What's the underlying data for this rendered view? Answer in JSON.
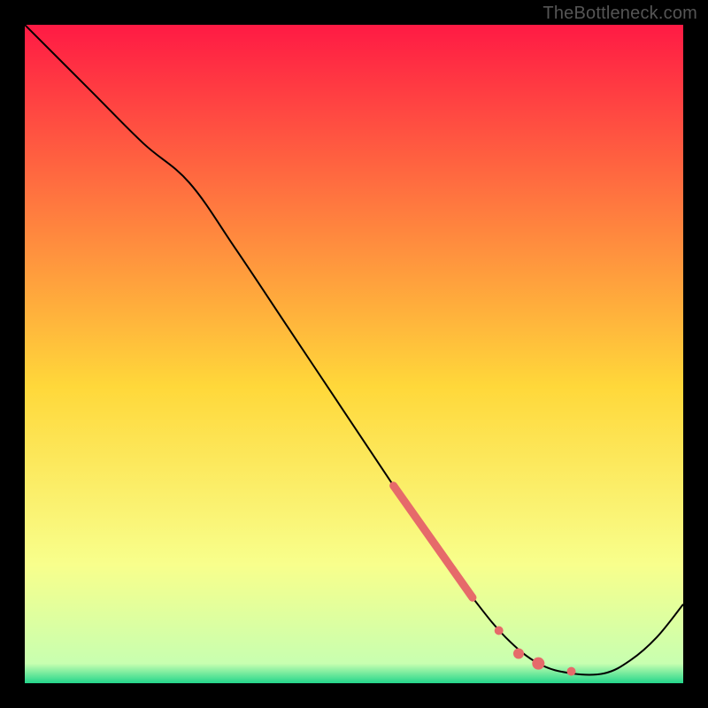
{
  "watermark": "TheBottleneck.com",
  "chart_data": {
    "type": "line",
    "title": "",
    "xlabel": "",
    "ylabel": "",
    "xlim": [
      0,
      100
    ],
    "ylim": [
      0,
      100
    ],
    "grid": false,
    "background_gradient": {
      "top_color": "#ff1a44",
      "mid_color": "#ffd83a",
      "bottom_upper": "#f8ff8c",
      "bottom_lower": "#23d68b"
    },
    "series": [
      {
        "name": "curve",
        "color": "#000000",
        "points": [
          {
            "x": 0,
            "y": 100
          },
          {
            "x": 10,
            "y": 90
          },
          {
            "x": 18,
            "y": 82
          },
          {
            "x": 25,
            "y": 76
          },
          {
            "x": 32,
            "y": 66
          },
          {
            "x": 40,
            "y": 54
          },
          {
            "x": 48,
            "y": 42
          },
          {
            "x": 56,
            "y": 30
          },
          {
            "x": 62,
            "y": 21
          },
          {
            "x": 68,
            "y": 13
          },
          {
            "x": 73,
            "y": 7
          },
          {
            "x": 78,
            "y": 3
          },
          {
            "x": 83,
            "y": 1.5
          },
          {
            "x": 88,
            "y": 1.5
          },
          {
            "x": 92,
            "y": 3.5
          },
          {
            "x": 96,
            "y": 7
          },
          {
            "x": 100,
            "y": 12
          }
        ]
      }
    ],
    "markers": [
      {
        "name": "highlight-segment",
        "type": "thick-line",
        "color": "#e66a6a",
        "width": 9,
        "points": [
          {
            "x": 56,
            "y": 30
          },
          {
            "x": 68,
            "y": 13
          }
        ]
      },
      {
        "name": "dot-a",
        "type": "dot",
        "color": "#e66a6a",
        "r": 5,
        "x": 72,
        "y": 8
      },
      {
        "name": "dot-b",
        "type": "dot",
        "color": "#e66a6a",
        "r": 6,
        "x": 75,
        "y": 4.5
      },
      {
        "name": "dot-c",
        "type": "dot",
        "color": "#e66a6a",
        "r": 7,
        "x": 78,
        "y": 3
      },
      {
        "name": "dot-d",
        "type": "dot",
        "color": "#e66a6a",
        "r": 5,
        "x": 83,
        "y": 1.8
      }
    ]
  }
}
